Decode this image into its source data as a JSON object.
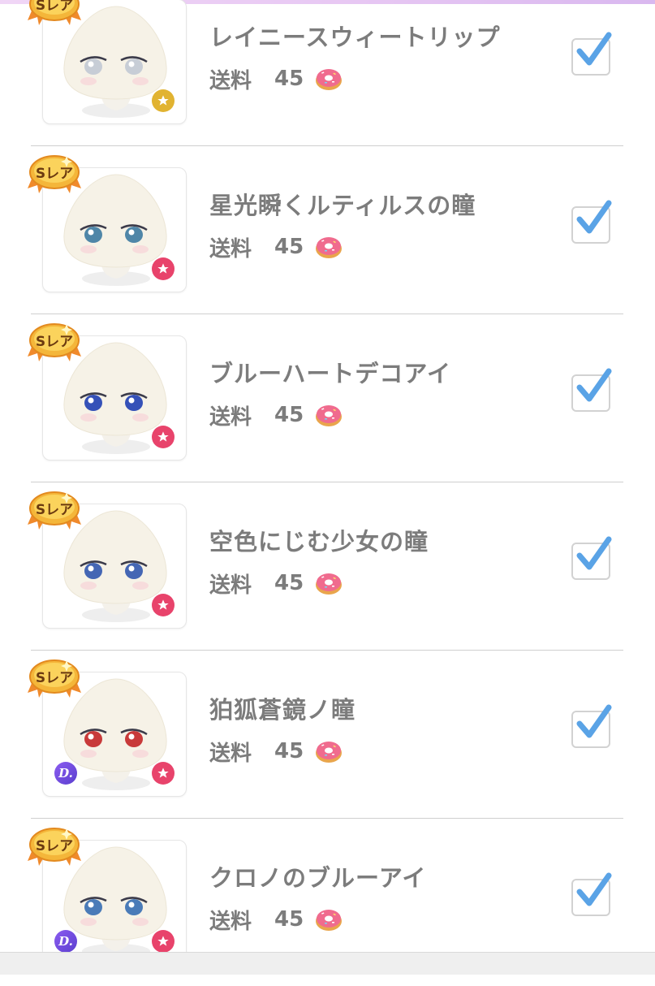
{
  "items": [
    {
      "rarity": "Sレア",
      "name": "レイニースウィートリップ",
      "fee_label": "送料",
      "fee": "45",
      "checked": true,
      "badge": "gold-star-icon",
      "d_badge": false,
      "eye_color": "#c7cdd6"
    },
    {
      "rarity": "Sレア",
      "name": "星光瞬くルティルスの瞳",
      "fee_label": "送料",
      "fee": "45",
      "checked": true,
      "badge": "pink-star-icon",
      "d_badge": false,
      "eye_color": "#4f86a8"
    },
    {
      "rarity": "Sレア",
      "name": "ブルーハートデコアイ",
      "fee_label": "送料",
      "fee": "45",
      "checked": true,
      "badge": "pink-star-icon",
      "d_badge": false,
      "eye_color": "#3551b8"
    },
    {
      "rarity": "Sレア",
      "name": "空色にじむ少女の瞳",
      "fee_label": "送料",
      "fee": "45",
      "checked": true,
      "badge": "pink-star-icon",
      "d_badge": false,
      "eye_color": "#4466b4"
    },
    {
      "rarity": "Sレア",
      "name": "狛狐蒼鏡ノ瞳",
      "fee_label": "送料",
      "fee": "45",
      "checked": true,
      "badge": "pink-star-icon",
      "d_badge": true,
      "d_label": "D.",
      "eye_color": "#c83a3a"
    },
    {
      "rarity": "Sレア",
      "name": "クロノのブルーアイ",
      "fee_label": "送料",
      "fee": "45",
      "checked": true,
      "badge": "pink-star-icon",
      "d_badge": true,
      "d_label": "D.",
      "eye_color": "#4a7bb8"
    }
  ]
}
